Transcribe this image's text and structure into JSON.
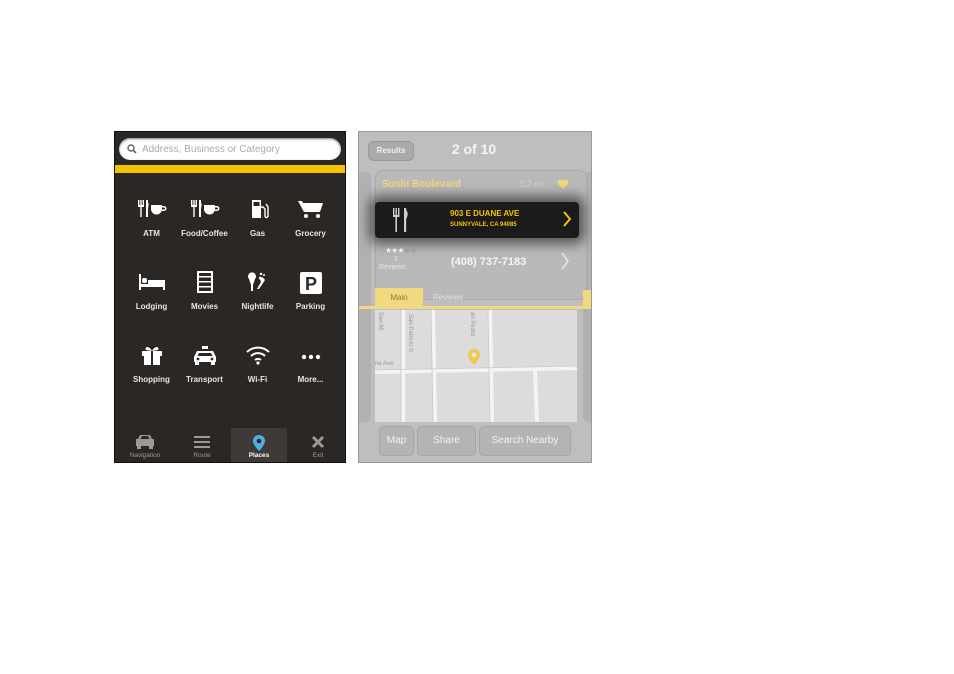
{
  "colors": {
    "accent": "#f5c400",
    "dark_bg": "#2b2725",
    "overlay_gray": "#bebebe"
  },
  "places_screen": {
    "search": {
      "placeholder": "Address, Business or Category",
      "icon": "search-icon"
    },
    "categories": [
      {
        "label": "ATM",
        "icon": "atm-icon"
      },
      {
        "label": "Food/Coffee",
        "icon": "food-coffee-icon"
      },
      {
        "label": "Gas",
        "icon": "gas-pump-icon"
      },
      {
        "label": "Grocery",
        "icon": "shopping-cart-icon"
      },
      {
        "label": "Lodging",
        "icon": "bed-icon"
      },
      {
        "label": "Movies",
        "icon": "film-icon"
      },
      {
        "label": "Nightlife",
        "icon": "nightlife-icon"
      },
      {
        "label": "Parking",
        "icon": "parking-icon"
      },
      {
        "label": "Shopping",
        "icon": "gift-icon"
      },
      {
        "label": "Transport",
        "icon": "taxi-icon"
      },
      {
        "label": "Wi-Fi",
        "icon": "wifi-icon"
      },
      {
        "label": "More...",
        "icon": "more-icon"
      }
    ],
    "tabs": [
      {
        "label": "Navigation",
        "icon": "car-icon"
      },
      {
        "label": "Route",
        "icon": "list-icon"
      },
      {
        "label": "Places",
        "icon": "location-pin-icon",
        "active": true
      },
      {
        "label": "Exit",
        "icon": "close-icon"
      }
    ]
  },
  "result_screen": {
    "back_label": "Results",
    "counter": "2 of 10",
    "place": {
      "name": "Sushi Boulevard",
      "distance": "0.2 mi",
      "address_line1": "903 E DUANE AVE",
      "address_line2": "SUNNYVALE, CA 94085",
      "rating": 3,
      "rating_max": 5,
      "review_count": "2",
      "review_label": "Reviews",
      "phone": "(408) 737-7183"
    },
    "tabs": [
      {
        "label": "Main",
        "active": true
      },
      {
        "label": "Reviews"
      }
    ],
    "map_labels": {
      "street1": "San Mi",
      "street2": "San Patricio S",
      "street3": "an Pedro",
      "street4": "ne Ave"
    },
    "actions": [
      {
        "label": "Map"
      },
      {
        "label": "Share"
      },
      {
        "label": "Search Nearby"
      }
    ]
  }
}
